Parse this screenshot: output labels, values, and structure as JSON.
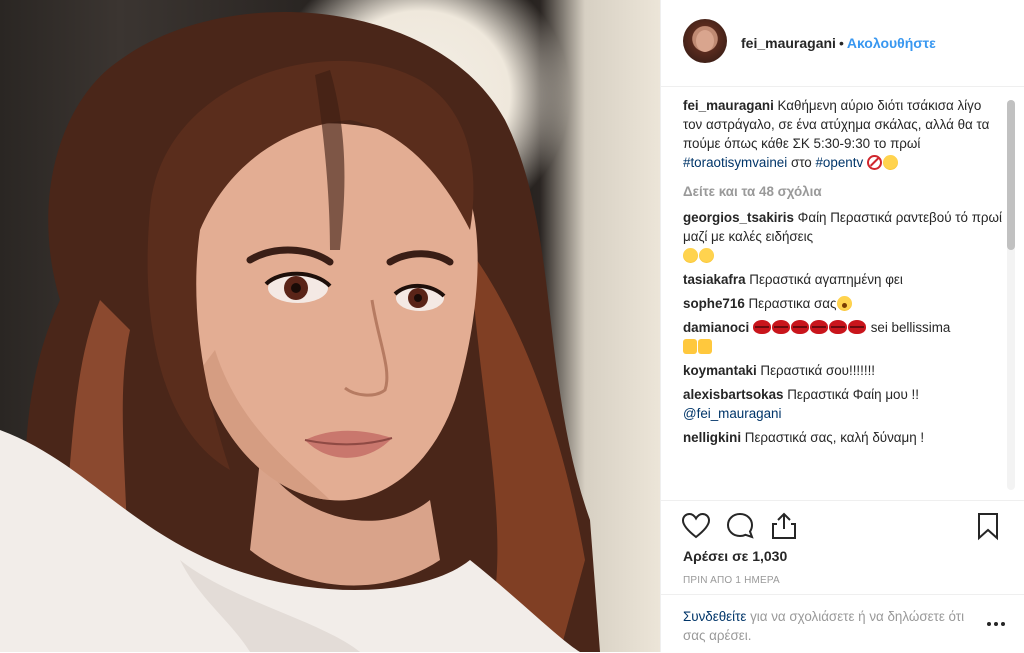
{
  "post": {
    "username": "fei_mauragani",
    "follow_label": "Ακολουθήστε",
    "caption": {
      "username": "fei_mauragani",
      "text": "Καθήμενη αύριο διότι τσάκισα λίγο τον αστράγαλο, σε ένα ατύχημα σκάλας, αλλά θα τα πούμε όπως κάθε ΣΚ 5:30-9:30 το πρωί",
      "hashtag": "#toraotisymvainei",
      "connector": "στο",
      "hashtag2": "#opentv"
    },
    "view_all": "Δείτε και τα 48 σχόλια",
    "comments": [
      {
        "user": "georgios_tsakiris",
        "text": "Φαίη Περαστικά ραντεβού τό πρωί μαζί με καλές ειδήσεις"
      },
      {
        "user": "tasiakafra",
        "text": "Περαστικά αγαπημένη φει"
      },
      {
        "user": "sophe716",
        "text": "Περαστικα σας"
      },
      {
        "user": "damianoci",
        "text": "sei bellissima"
      },
      {
        "user": "koymantaki",
        "text": "Περαστικά σου!!!!!!!"
      },
      {
        "user": "alexisbartsokas",
        "text": "Περαστικά Φαίη μου !!",
        "mention": "@fei_mauragani"
      },
      {
        "user": "nelligkini",
        "text": "Περαστικά σας, καλή δύναμη !"
      }
    ],
    "likes": "Αρέσει σε 1,030",
    "timestamp": "ΠΡΙΝ ΑΠΟ 1 ΗΜΕΡΑ",
    "login_link": "Συνδεθείτε",
    "login_text": "για να σχολιάσετε ή να δηλώσετε ότι σας αρέσει."
  },
  "icons": [
    "heart-icon",
    "comment-icon",
    "share-icon",
    "bookmark-icon",
    "more-options-icon"
  ],
  "colors": {
    "link": "#3897f0",
    "hashtag": "#003569",
    "muted": "#999999",
    "border": "#efefef"
  }
}
